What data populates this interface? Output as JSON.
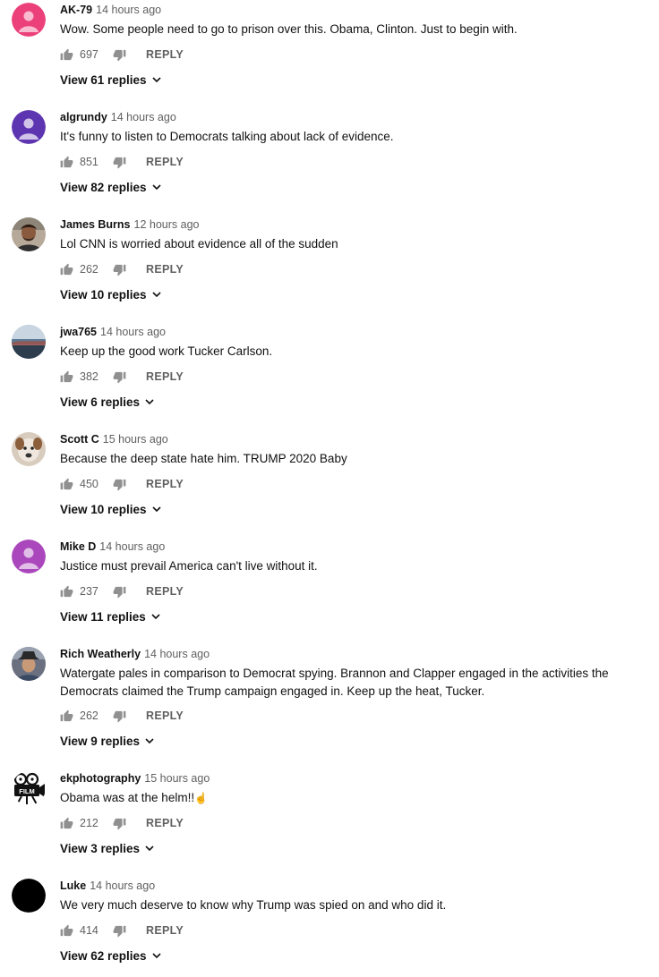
{
  "comments": [
    {
      "author": "AK-79",
      "time": "14 hours ago",
      "text": "Wow. Some people need to go to prison over this. Obama, Clinton. Just to begin with.",
      "likes": "697",
      "reply_label": "REPLY",
      "view_replies": "View 61 replies",
      "avatar": "pink-default-avatar",
      "avatar_color": "#ec407a"
    },
    {
      "author": "algrundy",
      "time": "14 hours ago",
      "text": "It's funny to listen to Democrats talking about lack of evidence.",
      "likes": "851",
      "reply_label": "REPLY",
      "view_replies": "View 82 replies",
      "avatar": "purple-default-avatar",
      "avatar_color": "#5e35b1"
    },
    {
      "author": "James Burns",
      "time": "12 hours ago",
      "text": "Lol CNN is worried about evidence all of the sudden",
      "likes": "262",
      "reply_label": "REPLY",
      "view_replies": "View 10 replies",
      "avatar": "photo-avatar-man",
      "avatar_color": "#7a6a5a"
    },
    {
      "author": "jwa765",
      "time": "14 hours ago",
      "text": "Keep up the good work Tucker Carlson.",
      "likes": "382",
      "reply_label": "REPLY",
      "view_replies": "View 6 replies",
      "avatar": "photo-avatar-landscape",
      "avatar_color": "#4a6a8a"
    },
    {
      "author": "Scott C",
      "time": "15 hours ago",
      "text": "Because the deep state hate him. TRUMP 2020 Baby",
      "likes": "450",
      "reply_label": "REPLY",
      "view_replies": "View 10 replies",
      "avatar": "photo-avatar-dog",
      "avatar_color": "#c9b8a6"
    },
    {
      "author": "Mike D",
      "time": "14 hours ago",
      "text": "Justice must prevail America can't live without it.",
      "likes": "237",
      "reply_label": "REPLY",
      "view_replies": "View 11 replies",
      "avatar": "magenta-default-avatar",
      "avatar_color": "#ab47bc"
    },
    {
      "author": "Rich Weatherly",
      "time": "14 hours ago",
      "text": "Watergate pales in comparison to Democrat spying. Brannon and Clapper engaged in the activities the Democrats claimed the Trump campaign engaged in. Keep up the heat, Tucker.",
      "likes": "262",
      "reply_label": "REPLY",
      "view_replies": "View 9 replies",
      "avatar": "photo-avatar-hat-man",
      "avatar_color": "#5a5a6a"
    },
    {
      "author": "ekphotography",
      "time": "15 hours ago",
      "text": "Obama was at the helm!!",
      "text_emoji": "☝",
      "likes": "212",
      "reply_label": "REPLY",
      "view_replies": "View 3 replies",
      "avatar": "film-camera-logo-avatar",
      "avatar_color": "#111111",
      "avatar_label": "FILM"
    },
    {
      "author": "Luke",
      "time": "14 hours ago",
      "text": "We very much deserve to know why Trump was spied on and who did it.",
      "likes": "414",
      "reply_label": "REPLY",
      "view_replies": "View 62 replies",
      "avatar": "black-avatar",
      "avatar_color": "#000000"
    }
  ],
  "colors": {
    "text": "#111111",
    "meta": "#606060",
    "icon": "#909090"
  }
}
